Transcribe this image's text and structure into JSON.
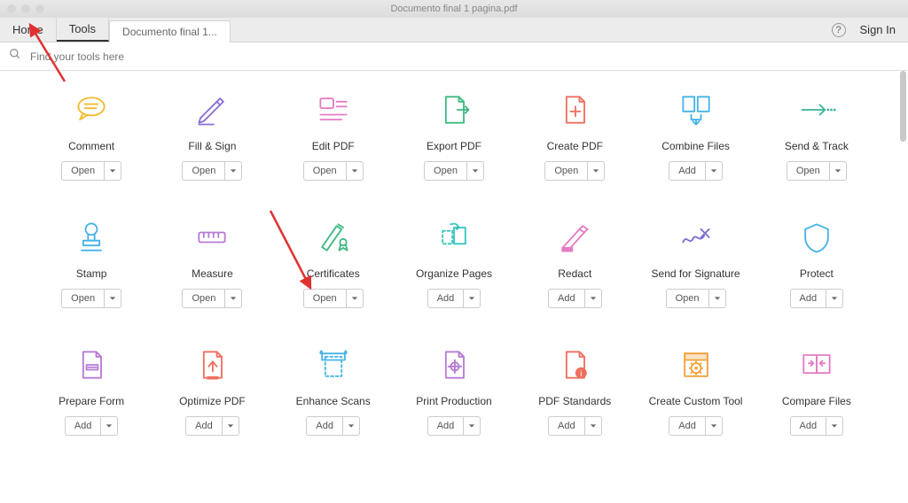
{
  "window": {
    "title": "Documento final 1 pagina.pdf"
  },
  "toolbar": {
    "home": "Home",
    "tools": "Tools",
    "doc_tab": "Documento final 1...",
    "signin": "Sign In"
  },
  "search": {
    "placeholder": "Find your tools here"
  },
  "buttons": {
    "open": "Open",
    "add": "Add"
  },
  "tools": [
    {
      "key": "comment",
      "label": "Comment",
      "action": "open"
    },
    {
      "key": "fill-sign",
      "label": "Fill & Sign",
      "action": "open"
    },
    {
      "key": "edit-pdf",
      "label": "Edit PDF",
      "action": "open"
    },
    {
      "key": "export-pdf",
      "label": "Export PDF",
      "action": "open"
    },
    {
      "key": "create-pdf",
      "label": "Create PDF",
      "action": "open"
    },
    {
      "key": "combine-files",
      "label": "Combine Files",
      "action": "add"
    },
    {
      "key": "send-track",
      "label": "Send & Track",
      "action": "open"
    },
    {
      "key": "stamp",
      "label": "Stamp",
      "action": "open"
    },
    {
      "key": "measure",
      "label": "Measure",
      "action": "open"
    },
    {
      "key": "certificates",
      "label": "Certificates",
      "action": "open"
    },
    {
      "key": "organize-pages",
      "label": "Organize Pages",
      "action": "add"
    },
    {
      "key": "redact",
      "label": "Redact",
      "action": "add"
    },
    {
      "key": "send-signature",
      "label": "Send for Signature",
      "action": "open"
    },
    {
      "key": "protect",
      "label": "Protect",
      "action": "add"
    },
    {
      "key": "prepare-form",
      "label": "Prepare Form",
      "action": "add"
    },
    {
      "key": "optimize-pdf",
      "label": "Optimize PDF",
      "action": "add"
    },
    {
      "key": "enhance-scans",
      "label": "Enhance Scans",
      "action": "add"
    },
    {
      "key": "print-production",
      "label": "Print Production",
      "action": "add"
    },
    {
      "key": "pdf-standards",
      "label": "PDF Standards",
      "action": "add"
    },
    {
      "key": "create-custom-tool",
      "label": "Create Custom Tool",
      "action": "add"
    },
    {
      "key": "compare-files",
      "label": "Compare Files",
      "action": "add"
    }
  ]
}
